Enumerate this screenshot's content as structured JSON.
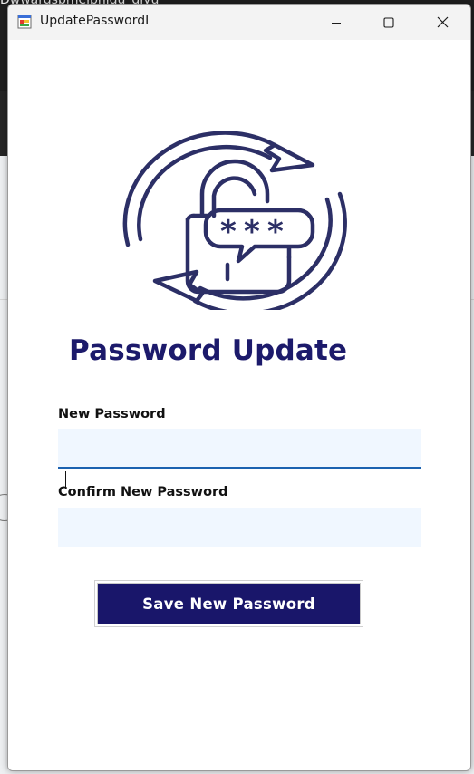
{
  "background": {
    "text": "Dwwardsbmelbniqu_qiyu"
  },
  "window": {
    "title": "UpdatePasswordI",
    "controls": {
      "minimize": "minimize-icon",
      "maximize": "maximize-icon",
      "close": "close-icon"
    }
  },
  "form": {
    "heading": "Password Update",
    "new_password": {
      "label": "New Password",
      "value": "",
      "placeholder": ""
    },
    "confirm_password": {
      "label": "Confirm New Password",
      "value": "",
      "placeholder": ""
    },
    "save_label": "Save New Password"
  },
  "colors": {
    "accent": "#19166a",
    "icon": "#2c2f66",
    "input_bg": "#f0f7ff",
    "focus_border": "#1c62b0"
  },
  "icons": {
    "app": "app-window-icon",
    "hero": "password-update-lock-icon"
  }
}
